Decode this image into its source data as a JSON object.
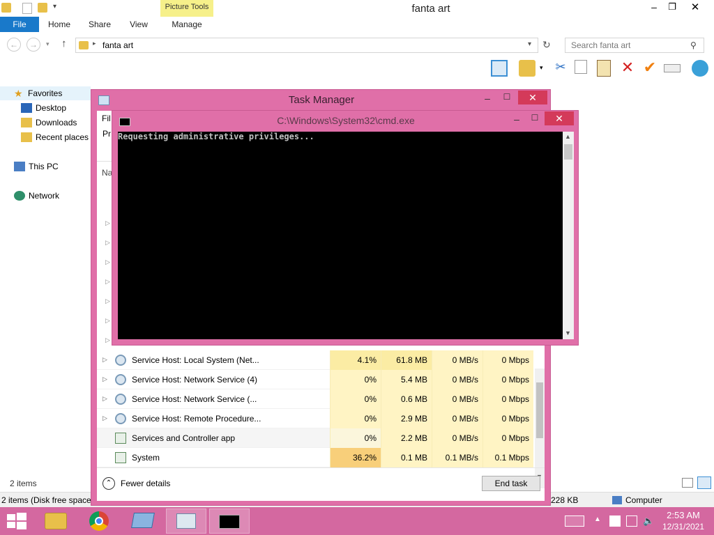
{
  "explorer": {
    "title": "fanta art",
    "context_tab": "Picture Tools",
    "tabs": [
      "File",
      "Home",
      "Share",
      "View",
      "Manage"
    ],
    "breadcrumb": "fanta art",
    "search_placeholder": "Search fanta art",
    "nav": {
      "favorites": "Favorites",
      "desktop": "Desktop",
      "downloads": "Downloads",
      "recent": "Recent places",
      "this_pc": "This PC",
      "network": "Network"
    },
    "status_items": "2 items",
    "bottom_left": "2 items (Disk free space:",
    "bottom_size": "228 KB",
    "bottom_computer": "Computer"
  },
  "task_manager": {
    "title": "Task Manager",
    "hidden_tabs": [
      "Fil",
      "Pr",
      "Na"
    ],
    "rows": [
      {
        "name": "Service Host: Local System (Net...",
        "cpu": "4.1%",
        "memory": "61.8 MB",
        "disk": "0 MB/s",
        "network": "0 Mbps",
        "expandable": true
      },
      {
        "name": "Service Host: Network Service (4)",
        "cpu": "0%",
        "memory": "5.4 MB",
        "disk": "0 MB/s",
        "network": "0 Mbps",
        "expandable": true
      },
      {
        "name": "Service Host: Network Service (...",
        "cpu": "0%",
        "memory": "0.6 MB",
        "disk": "0 MB/s",
        "network": "0 Mbps",
        "expandable": true
      },
      {
        "name": "Service Host: Remote Procedure...",
        "cpu": "0%",
        "memory": "2.9 MB",
        "disk": "0 MB/s",
        "network": "0 Mbps",
        "expandable": true
      },
      {
        "name": "Services and Controller app",
        "cpu": "0%",
        "memory": "2.2 MB",
        "disk": "0 MB/s",
        "network": "0 Mbps",
        "expandable": false
      },
      {
        "name": "System",
        "cpu": "36.2%",
        "memory": "0.1 MB",
        "disk": "0.1 MB/s",
        "network": "0.1 Mbps",
        "expandable": false
      }
    ],
    "fewer_details": "Fewer details",
    "end_task": "End task"
  },
  "cmd": {
    "title": "C:\\Windows\\System32\\cmd.exe",
    "text": "Requesting administrative privileges..."
  },
  "taskbar": {
    "time": "2:53 AM",
    "date": "12/31/2021"
  },
  "colors": {
    "accent_pink": "#e06fa8",
    "taskbar": "#d468a0",
    "file_tab": "#1979ca",
    "cpu_high": "#f8cf7a"
  }
}
